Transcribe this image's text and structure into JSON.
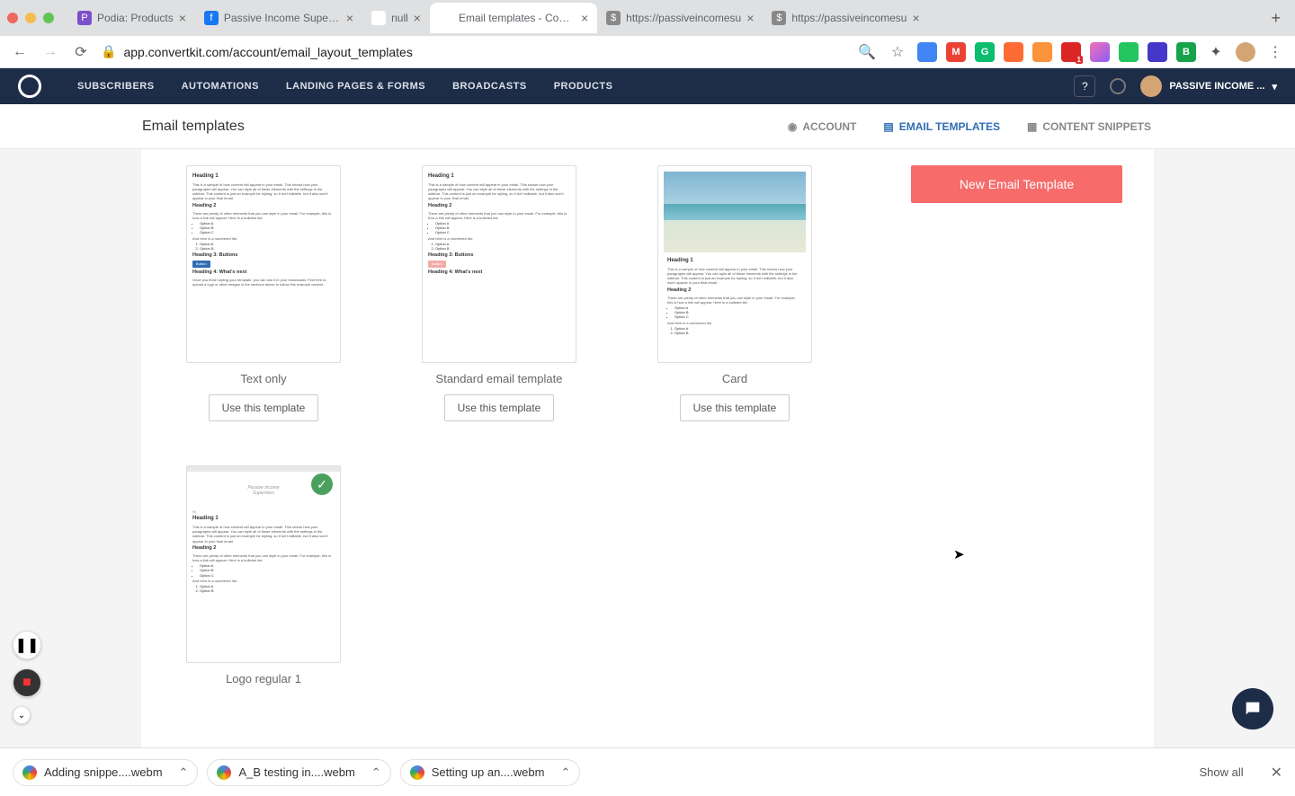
{
  "browserTabs": [
    {
      "title": "Podia: Products",
      "favicon": "P",
      "faviconBg": "#7b4fc9"
    },
    {
      "title": "Passive Income Supersta",
      "favicon": "f",
      "faviconBg": "#1877f2"
    },
    {
      "title": "null",
      "favicon": "○",
      "faviconBg": "#fff"
    },
    {
      "title": "Email templates - Conver",
      "favicon": "○",
      "faviconBg": "#fff",
      "active": true
    },
    {
      "title": "https://passiveincomesu",
      "favicon": "$",
      "faviconBg": "#888"
    },
    {
      "title": "https://passiveincomesu",
      "favicon": "$",
      "faviconBg": "#888"
    }
  ],
  "url": "app.convertkit.com/account/email_layout_templates",
  "appNav": [
    "SUBSCRIBERS",
    "AUTOMATIONS",
    "LANDING PAGES & FORMS",
    "BROADCASTS",
    "PRODUCTS"
  ],
  "userName": "PASSIVE INCOME ...",
  "pageTitle": "Email templates",
  "subTabs": [
    {
      "label": "ACCOUNT",
      "icon": "user"
    },
    {
      "label": "EMAIL TEMPLATES",
      "icon": "doc",
      "active": true
    },
    {
      "label": "CONTENT SNIPPETS",
      "icon": "snip"
    }
  ],
  "newTemplateBtn": "New Email Template",
  "templates": [
    {
      "name": "Text only",
      "button": "Use this template"
    },
    {
      "name": "Standard email template",
      "button": "Use this template"
    },
    {
      "name": "Card",
      "button": "Use this template"
    },
    {
      "name": "Logo regular 1"
    }
  ],
  "preview": {
    "h1": "Heading 1",
    "p1": "This is a sample of how content will appear in your email. This shows how your paragraphs will appear. You can style all of these elements with the settings in the sidebar. This content is just an example for styling, so it isn't editable, but it also won't appear in your final email.",
    "h2": "Heading 2",
    "p2": "There are plenty of other elements that you can style in your email. For example, this is how a link will appear. Here is a bulleted list:",
    "bullets": [
      "Option A",
      "Option B",
      "Option C"
    ],
    "numlabel": "And here is a numbered list:",
    "nums": [
      "Option A",
      "Option B"
    ],
    "h3": "Heading 3: Buttons",
    "btn": "Button",
    "h4": "Heading 4: What's next",
    "p3": "Once you finish styling your template, you can use it in your broadcasts. Feel free to upload a logo or other images in the sections above to follow this example content."
  },
  "downloads": [
    {
      "name": "Adding snippe....webm"
    },
    {
      "name": "A_B testing in....webm"
    },
    {
      "name": "Setting up an....webm"
    }
  ],
  "showAll": "Show all"
}
